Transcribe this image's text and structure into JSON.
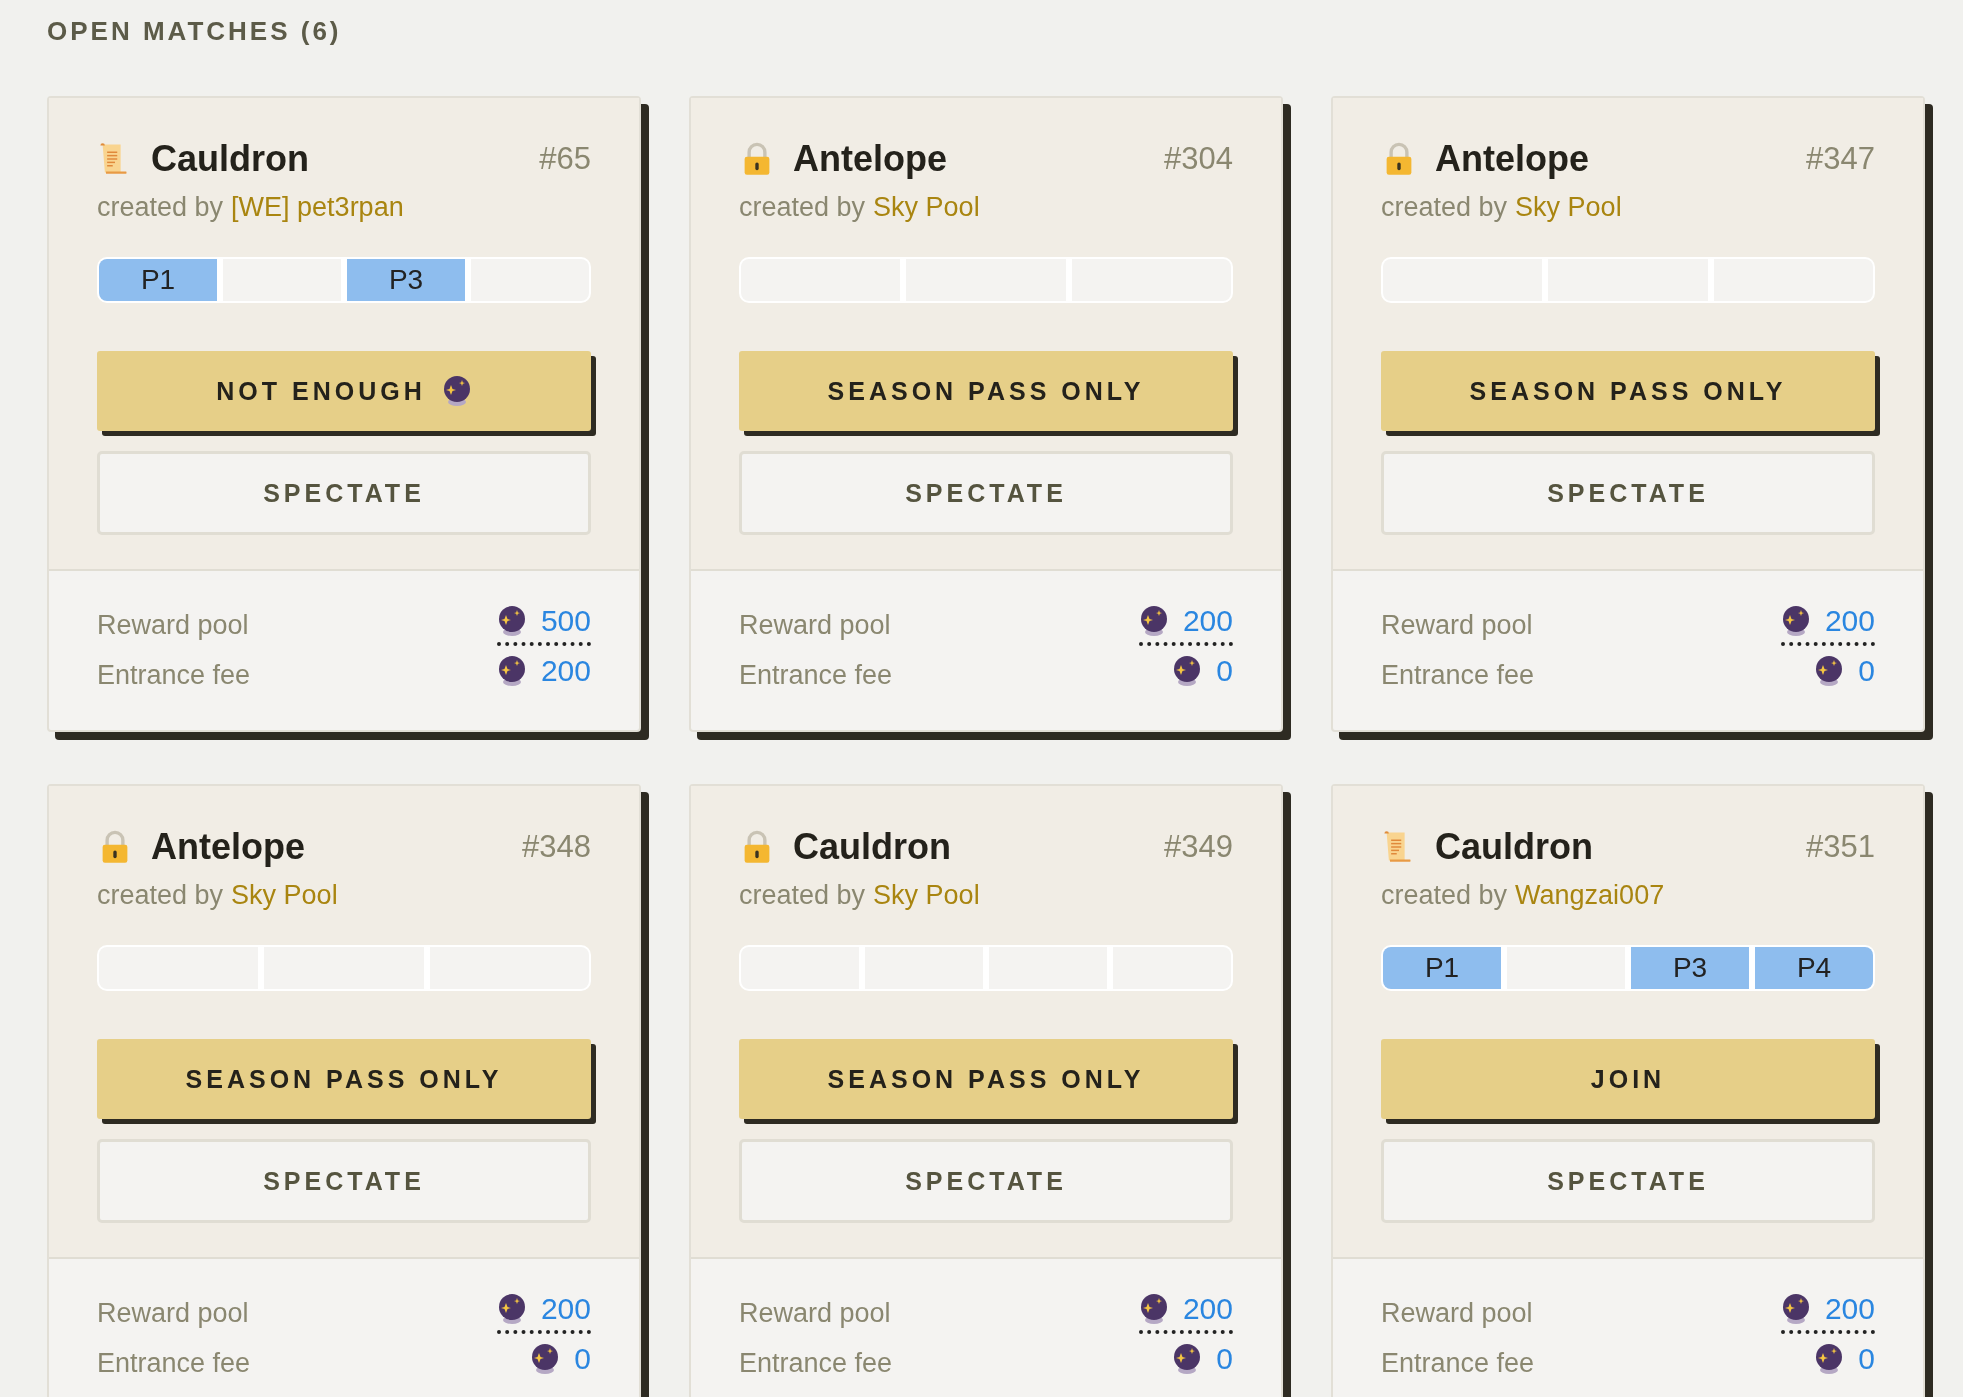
{
  "heading": "OPEN MATCHES (6)",
  "matches": [
    {
      "name": "Cauldron",
      "number": "#65",
      "locked": false,
      "created_by": "created by",
      "creator": "[WE] pet3rpan",
      "slots": [
        {
          "label": "P1",
          "filled": true
        },
        {
          "filled": false
        },
        {
          "label": "P3",
          "filled": true
        },
        {
          "filled": false
        }
      ],
      "action": {
        "label": "NOT ENOUGH",
        "currency_icon": true
      },
      "spectate": "SPECTATE",
      "stats": [
        {
          "label": "Reward pool",
          "value": "500"
        },
        {
          "label": "Entrance fee",
          "value": "200"
        }
      ]
    },
    {
      "name": "Antelope",
      "number": "#304",
      "locked": true,
      "created_by": "created by",
      "creator": "Sky Pool",
      "slots": [
        {
          "filled": false
        },
        {
          "filled": false
        },
        {
          "filled": false
        }
      ],
      "action": {
        "label": "SEASON PASS ONLY",
        "currency_icon": false
      },
      "spectate": "SPECTATE",
      "stats": [
        {
          "label": "Reward pool",
          "value": "200"
        },
        {
          "label": "Entrance fee",
          "value": "0"
        }
      ]
    },
    {
      "name": "Antelope",
      "number": "#347",
      "locked": true,
      "created_by": "created by",
      "creator": "Sky Pool",
      "slots": [
        {
          "filled": false
        },
        {
          "filled": false
        },
        {
          "filled": false
        }
      ],
      "action": {
        "label": "SEASON PASS ONLY",
        "currency_icon": false
      },
      "spectate": "SPECTATE",
      "stats": [
        {
          "label": "Reward pool",
          "value": "200"
        },
        {
          "label": "Entrance fee",
          "value": "0"
        }
      ]
    },
    {
      "name": "Antelope",
      "number": "#348",
      "locked": true,
      "created_by": "created by",
      "creator": "Sky Pool",
      "slots": [
        {
          "filled": false
        },
        {
          "filled": false
        },
        {
          "filled": false
        }
      ],
      "action": {
        "label": "SEASON PASS ONLY",
        "currency_icon": false
      },
      "spectate": "SPECTATE",
      "stats": [
        {
          "label": "Reward pool",
          "value": "200"
        },
        {
          "label": "Entrance fee",
          "value": "0"
        }
      ]
    },
    {
      "name": "Cauldron",
      "number": "#349",
      "locked": true,
      "created_by": "created by",
      "creator": "Sky Pool",
      "slots": [
        {
          "filled": false
        },
        {
          "filled": false
        },
        {
          "filled": false
        },
        {
          "filled": false
        }
      ],
      "action": {
        "label": "SEASON PASS ONLY",
        "currency_icon": false
      },
      "spectate": "SPECTATE",
      "stats": [
        {
          "label": "Reward pool",
          "value": "200"
        },
        {
          "label": "Entrance fee",
          "value": "0"
        }
      ]
    },
    {
      "name": "Cauldron",
      "number": "#351",
      "locked": false,
      "created_by": "created by",
      "creator": "Wangzai007",
      "slots": [
        {
          "label": "P1",
          "filled": true
        },
        {
          "filled": false
        },
        {
          "label": "P3",
          "filled": true
        },
        {
          "label": "P4",
          "filled": true
        }
      ],
      "action": {
        "label": "JOIN",
        "currency_icon": false
      },
      "spectate": "SPECTATE",
      "stats": [
        {
          "label": "Reward pool",
          "value": "200"
        },
        {
          "label": "Entrance fee",
          "value": "0"
        }
      ]
    }
  ]
}
